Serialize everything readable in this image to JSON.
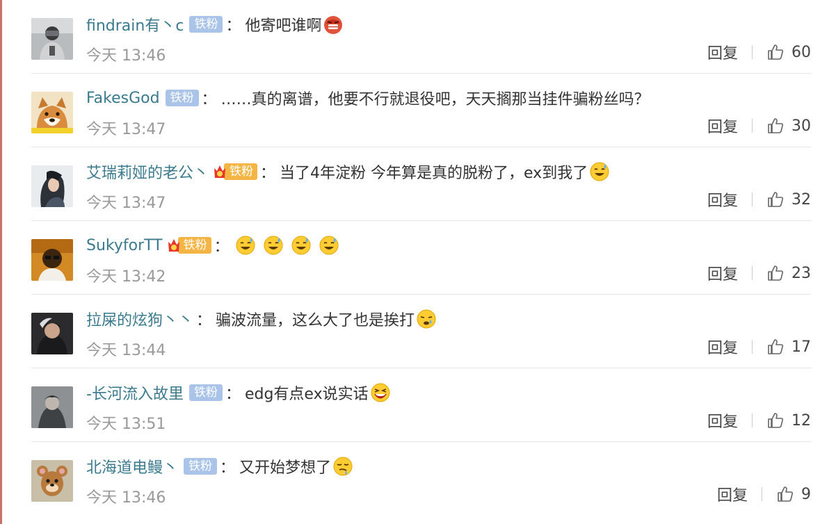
{
  "comments": [
    {
      "username": "findrain有丶c",
      "badge": "铁粉",
      "badge_type": "fan",
      "separator": "：",
      "text": "他寄吧谁啊",
      "emojis": [
        "angry-face-icon"
      ],
      "time": "今天 13:46",
      "reply": "回复",
      "likes": "60"
    },
    {
      "username": "FakesGod",
      "badge": "铁粉",
      "badge_type": "fan",
      "separator": "：",
      "text": "……真的离谱，他要不行就退役吧，天天搁那当挂件骗粉丝吗？",
      "emojis": [],
      "time": "今天 13:47",
      "reply": "回复",
      "likes": "30"
    },
    {
      "username": "艾瑞莉娅的老公丶",
      "badge": "铁粉",
      "badge_type": "vip",
      "separator": "：",
      "text": "当了4年淀粉 今年算是真的脱粉了，ex到我了",
      "emojis": [
        "sweat-smile-icon"
      ],
      "time": "今天 13:47",
      "reply": "回复",
      "likes": "32"
    },
    {
      "username": "SukyforTT",
      "badge": "铁粉",
      "badge_type": "vip",
      "separator": "：",
      "text": "",
      "emojis": [
        "sweat-smile-icon",
        "sweat-smile-icon",
        "sweat-smile-icon",
        "sweat-smile-icon"
      ],
      "time": "今天 13:42",
      "reply": "回复",
      "likes": "23"
    },
    {
      "username": "拉屎的炫狗丶丶",
      "badge": "",
      "badge_type": "none",
      "separator": "：",
      "text": "骗波流量，这么大了也是挨打",
      "emojis": [
        "tired-face-icon"
      ],
      "time": "今天 13:44",
      "reply": "回复",
      "likes": "17"
    },
    {
      "username": "-长河流入故里",
      "badge": "铁粉",
      "badge_type": "fan",
      "separator": "：",
      "text": "edg有点ex说实话",
      "emojis": [
        "laughing-face-icon"
      ],
      "time": "今天 13:51",
      "reply": "回复",
      "likes": "12"
    },
    {
      "username": "北海道电鳗丶",
      "badge": "铁粉",
      "badge_type": "fan",
      "separator": "：",
      "text": "又开始梦想了",
      "emojis": [
        "drool-face-icon"
      ],
      "time": "今天 13:46",
      "reply": "回复",
      "likes": "9"
    }
  ],
  "colors": {
    "username": "#3a7a8e",
    "fan_badge": "#a9c4e8",
    "vip_badge": "#f5b544",
    "meta_text": "#999999",
    "left_border": "#c9716a"
  }
}
